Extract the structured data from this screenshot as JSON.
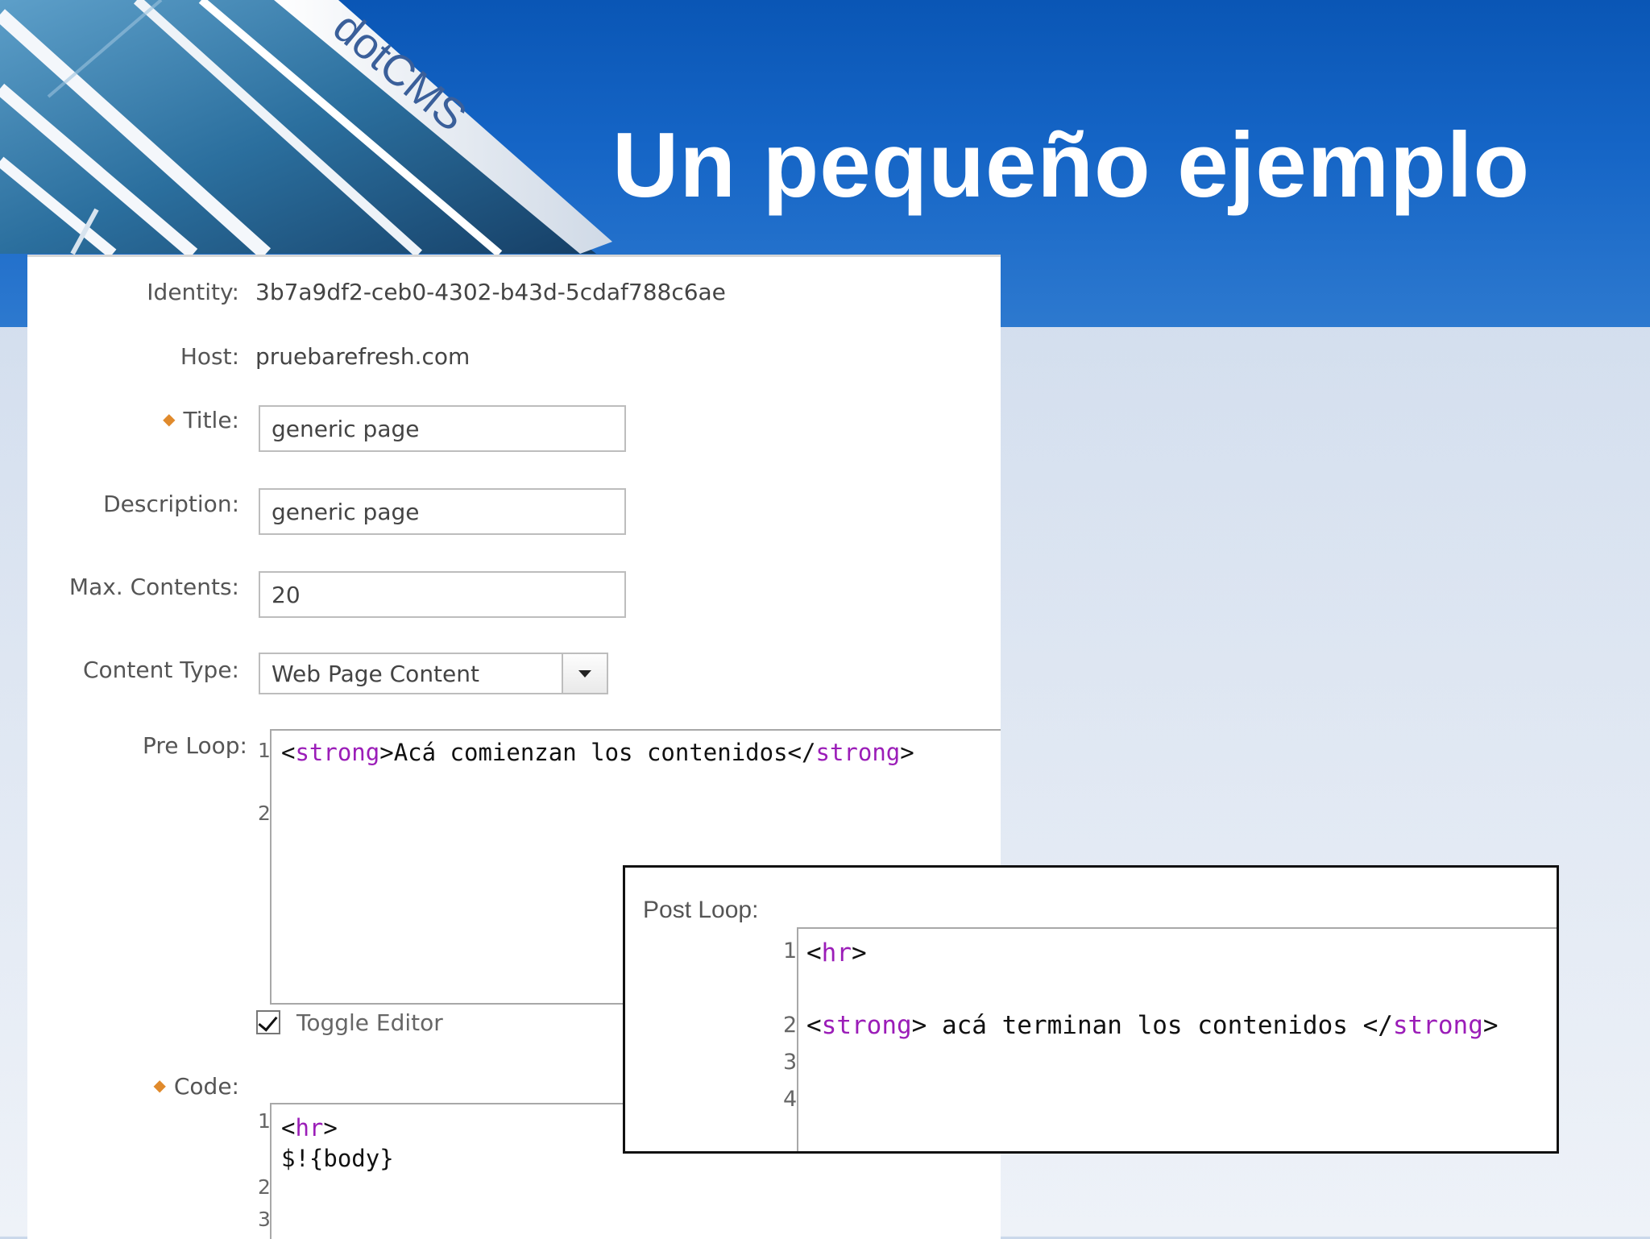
{
  "slide": {
    "title": "Un pequeño ejemplo",
    "logo_text": "dotCMS"
  },
  "form": {
    "identity": {
      "label": "Identity:",
      "value": "3b7a9df2-ceb0-4302-b43d-5cdaf788c6ae"
    },
    "host": {
      "label": "Host:",
      "value": "pruebarefresh.com"
    },
    "title": {
      "label": "Title:",
      "value": "generic page",
      "required": true
    },
    "description": {
      "label": "Description:",
      "value": "generic page"
    },
    "max_contents": {
      "label": "Max. Contents:",
      "value": "20"
    },
    "content_type": {
      "label": "Content Type:",
      "selected": "Web Page Content"
    },
    "pre_loop": {
      "label": "Pre Loop:",
      "lines": [
        {
          "n": "1",
          "open": "<",
          "tag1": "strong",
          "mid": ">Acá comienzan los contenidos</",
          "tag2": "strong",
          "close": ">"
        },
        {
          "n": "2"
        }
      ]
    },
    "toggle_editor": {
      "label": "Toggle Editor",
      "checked": true
    },
    "code": {
      "label": "Code:",
      "required": true,
      "lines": [
        {
          "n": "1",
          "open": "<",
          "tag": "hr",
          "close": ">",
          "text": "$!{body}"
        },
        {
          "n": "2"
        },
        {
          "n": "3"
        }
      ]
    }
  },
  "post_loop": {
    "label": "Post Loop:",
    "lines": [
      {
        "n": "1",
        "open": "<",
        "tag": "hr",
        "close": ">"
      },
      {
        "n": "2",
        "open": "<",
        "tag1": "strong",
        "mid": "> acá terminan los contenidos </",
        "tag2": "strong",
        "close": ">"
      },
      {
        "n": "3"
      },
      {
        "n": "4"
      }
    ]
  },
  "colors": {
    "banner_blue": "#1565c6",
    "code_tag": "#9b1db8",
    "required_marker": "#e08a2c"
  },
  "icons": {
    "required_marker": "required-diamond-icon",
    "dropdown": "chevron-down-icon",
    "checkbox": "check-icon"
  }
}
